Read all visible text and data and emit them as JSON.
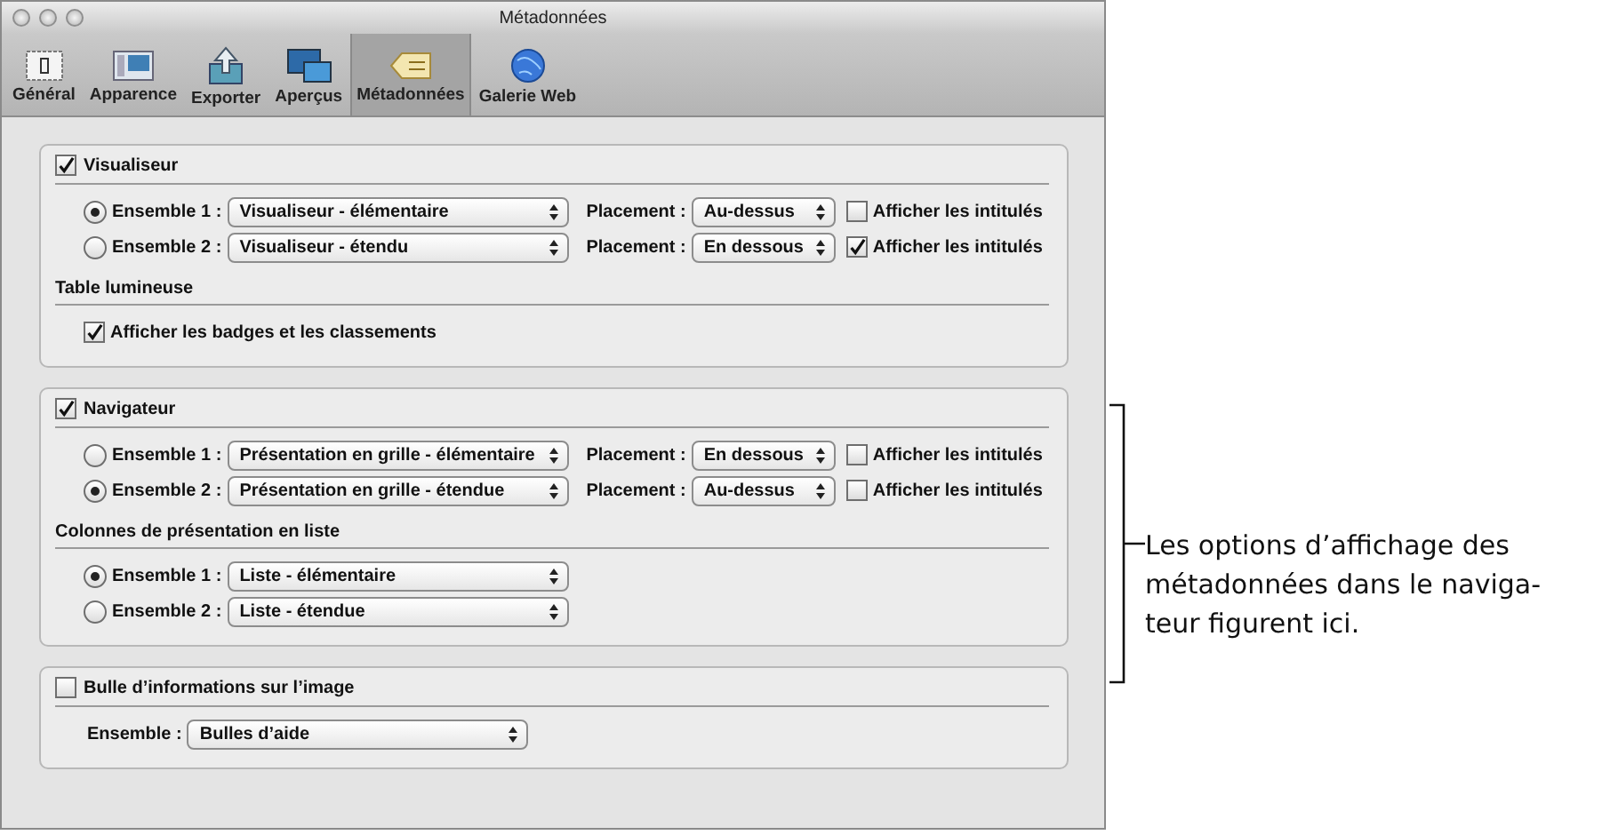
{
  "window": {
    "title": "Métadonnées"
  },
  "toolbar": [
    {
      "label": "Général",
      "selected": false
    },
    {
      "label": "Apparence",
      "selected": false
    },
    {
      "label": "Exporter",
      "selected": false
    },
    {
      "label": "Aperçus",
      "selected": false
    },
    {
      "label": "Métadonnées",
      "selected": true
    },
    {
      "label": "Galerie Web",
      "selected": false
    }
  ],
  "sections": [
    {
      "title": "Visualiseur",
      "checked": true,
      "items": [
        {
          "kind": "set",
          "label": "Ensemble 1 :",
          "selected": true,
          "value": "Visualiseur - élémentaire",
          "placement_label": "Placement :",
          "placement": "Au-dessus",
          "option_label": "Afficher les intitulés",
          "option_checked": false
        },
        {
          "kind": "set",
          "label": "Ensemble 2 :",
          "selected": false,
          "value": "Visualiseur - étendu",
          "placement_label": "Placement :",
          "placement": "En dessous",
          "option_label": "Afficher les intitulés",
          "option_checked": true
        },
        {
          "kind": "heading",
          "label": "Table lumineuse"
        },
        {
          "kind": "check",
          "label": "Afficher les badges et les classements",
          "checked": true
        }
      ]
    },
    {
      "title": "Navigateur",
      "checked": true,
      "items": [
        {
          "kind": "set",
          "label": "Ensemble 1 :",
          "selected": false,
          "value": "Présentation en grille - élémentaire",
          "placement_label": "Placement :",
          "placement": "En dessous",
          "option_label": "Afficher les intitulés",
          "option_checked": false
        },
        {
          "kind": "set",
          "label": "Ensemble 2 :",
          "selected": true,
          "value": "Présentation en grille - étendue",
          "placement_label": "Placement :",
          "placement": "Au-dessus",
          "option_label": "Afficher les intitulés",
          "option_checked": false
        },
        {
          "kind": "heading",
          "label": "Colonnes de présentation en liste"
        },
        {
          "kind": "list",
          "label": "Ensemble 1 :",
          "selected": true,
          "value": "Liste - élémentaire"
        },
        {
          "kind": "list",
          "label": "Ensemble 2 :",
          "selected": false,
          "value": "Liste - étendue"
        }
      ]
    },
    {
      "title": "Bulle d’informations sur l’image",
      "checked": false,
      "items": [
        {
          "kind": "field",
          "label": "Ensemble :",
          "value": "Bulles d’aide"
        }
      ]
    }
  ],
  "callout": {
    "lines": [
      "Les options d’affichage des",
      "métadonnées dans le naviga-",
      "teur figurent ici."
    ]
  }
}
